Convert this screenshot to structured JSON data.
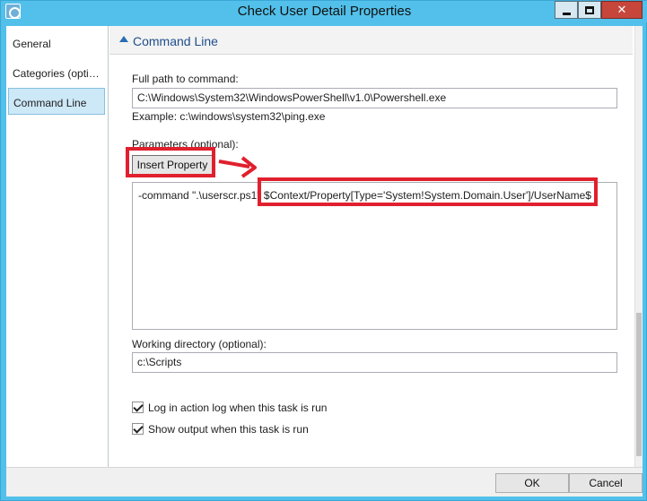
{
  "window": {
    "title": "Check User Detail Properties"
  },
  "nav": {
    "items": [
      {
        "label": "General",
        "selected": false
      },
      {
        "label": "Categories (opti…",
        "selected": false
      },
      {
        "label": "Command Line",
        "selected": true
      }
    ]
  },
  "section": {
    "title": "Command Line"
  },
  "form": {
    "full_path_label": "Full path to command:",
    "full_path_value": "C:\\Windows\\System32\\WindowsPowerShell\\v1.0\\Powershell.exe",
    "example": "Example: c:\\windows\\system32\\ping.exe",
    "parameters_label": "Parameters (optional):",
    "insert_property_label": "Insert Property",
    "parameters_prefix": "-command \".\\userscr.ps1\" ",
    "parameters_property": "$Context/Property[Type='System!System.Domain.User']/UserName$",
    "working_dir_label": "Working directory (optional):",
    "working_dir_value": "c:\\Scripts",
    "log_checkbox_label": "Log in action log when this task is run",
    "log_checked": true,
    "output_checkbox_label": "Show output when this task is run",
    "output_checked": true
  },
  "footer": {
    "ok_label": "OK",
    "cancel_label": "Cancel"
  },
  "colors": {
    "titlebar": "#52c0ea",
    "annotation": "#e0202e",
    "accent": "#1f4e8c"
  }
}
